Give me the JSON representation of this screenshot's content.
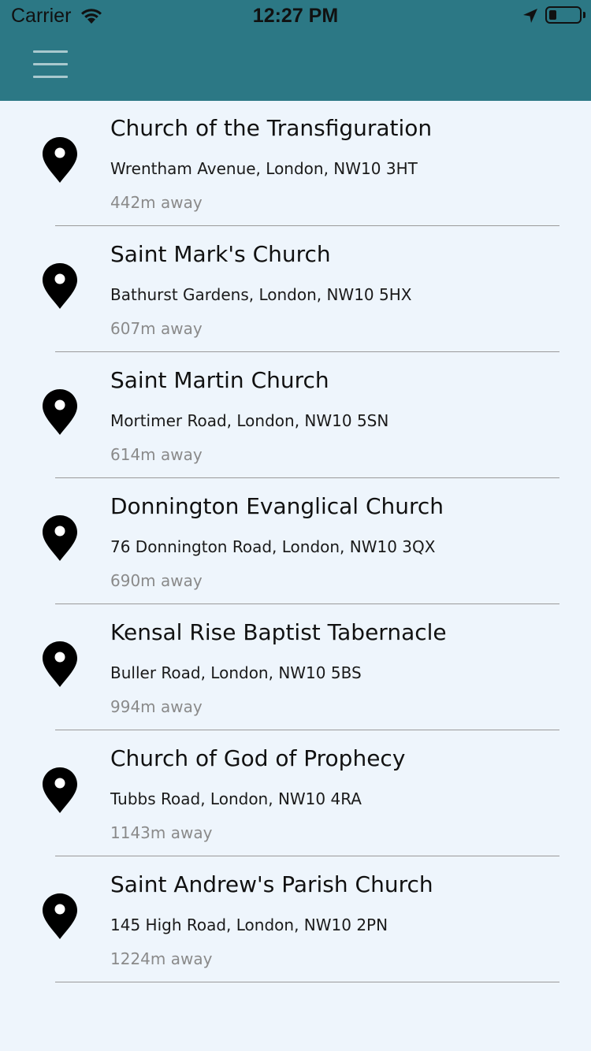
{
  "status_bar": {
    "carrier": "Carrier",
    "time": "12:27 PM",
    "icons": [
      "wifi-icon",
      "location-arrow-icon",
      "battery-icon"
    ]
  },
  "header": {
    "menu_icon": "hamburger-menu-icon",
    "background_color": "#2c7885"
  },
  "churches": [
    {
      "name": "Church of the Transfiguration",
      "address": "Wrentham Avenue, London, NW10 3HT",
      "distance": "442m away"
    },
    {
      "name": "Saint Mark's Church",
      "address": "Bathurst Gardens, London, NW10 5HX",
      "distance": "607m away"
    },
    {
      "name": "Saint Martin Church",
      "address": "Mortimer Road, London, NW10 5SN",
      "distance": "614m away"
    },
    {
      "name": "Donnington Evanglical Church",
      "address": "76 Donnington Road, London, NW10 3QX",
      "distance": "690m away"
    },
    {
      "name": "Kensal Rise Baptist Tabernacle",
      "address": "Buller Road, London, NW10 5BS",
      "distance": "994m away"
    },
    {
      "name": "Church of God of Prophecy",
      "address": "Tubbs Road, London, NW10 4RA",
      "distance": "1143m away"
    },
    {
      "name": "Saint Andrew's Parish Church",
      "address": "145 High Road, London, NW10 2PN",
      "distance": "1224m away"
    }
  ],
  "list_icon": "map-pin-icon"
}
